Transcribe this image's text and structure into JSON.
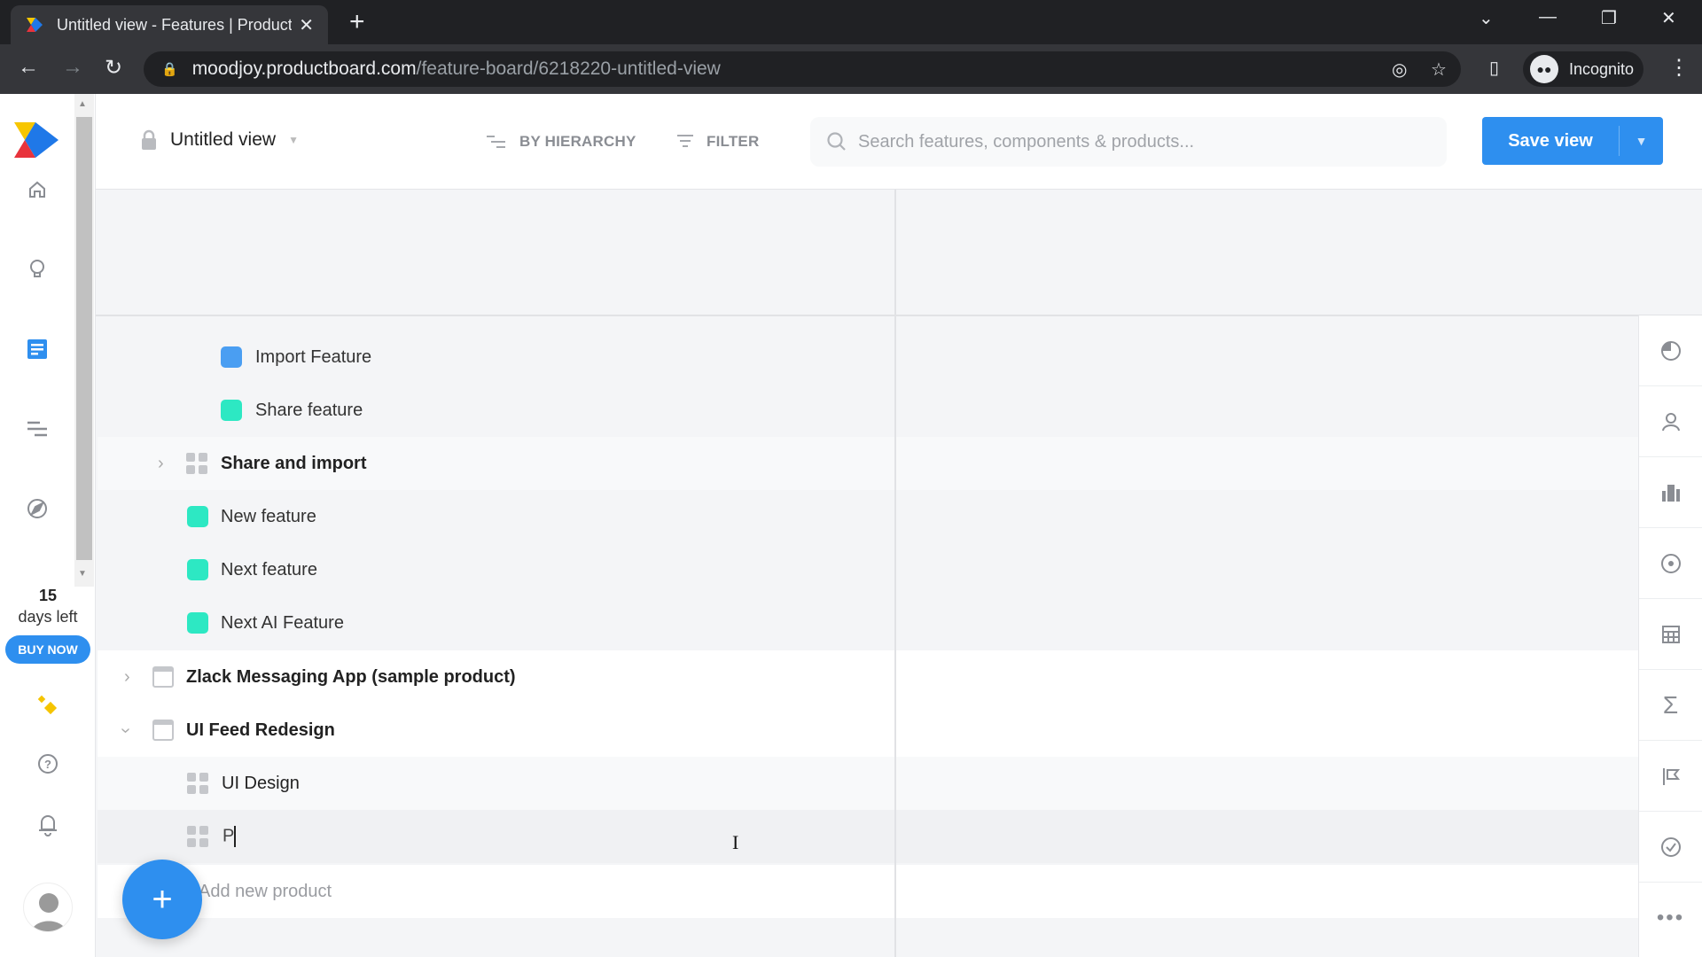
{
  "browser": {
    "tab_title": "Untitled view - Features | Product",
    "url_host": "moodjoy.productboard.com",
    "url_path": "/feature-board/6218220-untitled-view",
    "profile_label": "Incognito"
  },
  "leftnav": {
    "items": [
      {
        "name": "home",
        "icon": "home-icon"
      },
      {
        "name": "insights",
        "icon": "lightbulb-icon"
      },
      {
        "name": "features",
        "icon": "document-list-icon",
        "active": true
      },
      {
        "name": "roadmaps",
        "icon": "roadmap-lines-icon"
      },
      {
        "name": "discovery",
        "icon": "compass-icon"
      }
    ],
    "trial_days": "15",
    "trial_label": "days left",
    "buy_now": "BUY NOW"
  },
  "toolbar": {
    "view_name": "Untitled view",
    "group_by": "BY HIERARCHY",
    "filter": "FILTER",
    "search_placeholder": "Search features, components & products...",
    "save_label": "Save view"
  },
  "colors": {
    "accent": "#2e8fef",
    "feature_blue": "#4a9ef2",
    "feature_teal": "#2de8c3"
  },
  "rows": [
    {
      "label": "Import Feature",
      "type": "feature",
      "color": "#4a9ef2"
    },
    {
      "label": "Share feature",
      "type": "feature",
      "color": "#2de8c3"
    },
    {
      "label": "Share and import",
      "type": "component",
      "collapsed": true
    },
    {
      "label": "New feature",
      "type": "feature",
      "color": "#2de8c3"
    },
    {
      "label": "Next feature",
      "type": "feature",
      "color": "#2de8c3"
    },
    {
      "label": "Next AI Feature",
      "type": "feature",
      "color": "#2de8c3"
    },
    {
      "label": "Zlack Messaging App (sample product)",
      "type": "product",
      "collapsed": true
    },
    {
      "label": "UI Feed Redesign",
      "type": "product",
      "collapsed": false
    },
    {
      "label": "UI Design",
      "type": "component"
    },
    {
      "label": "P",
      "type": "component",
      "editing": true
    }
  ],
  "add_product_label": "Add new product",
  "right_panel_icons": [
    "pie-chart-icon",
    "user-icon",
    "building-icon",
    "target-icon",
    "calculator-icon",
    "sigma-icon",
    "flag-icon",
    "check-circle-icon",
    "more-icon"
  ]
}
